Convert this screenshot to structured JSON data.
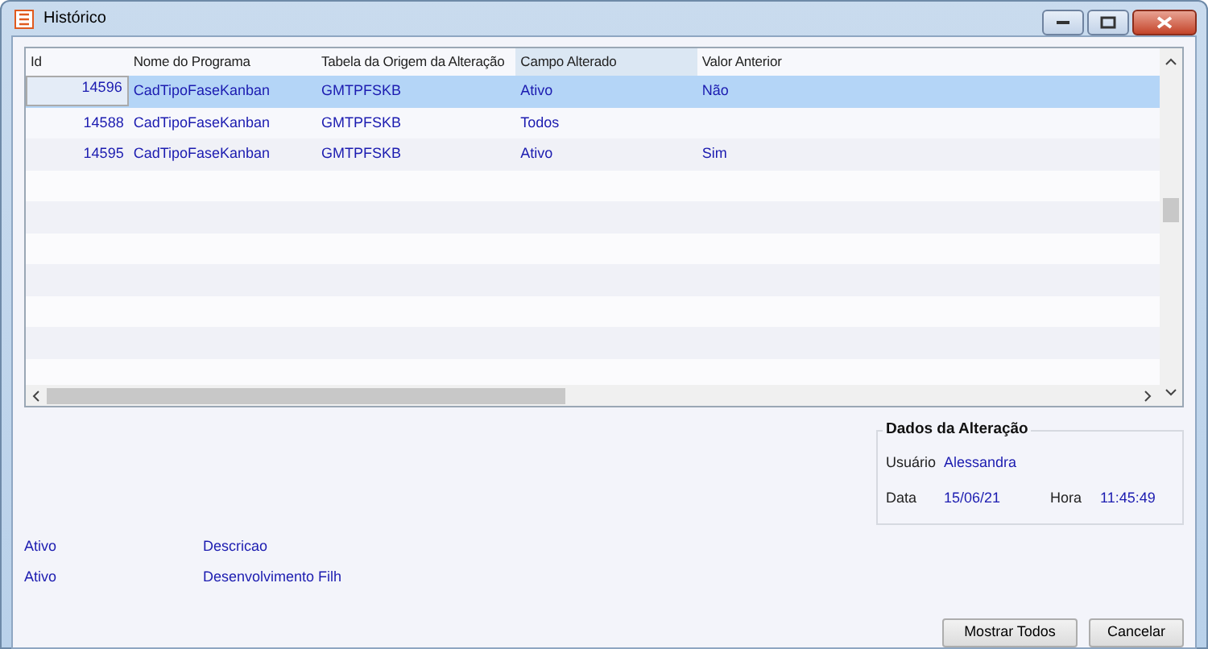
{
  "window": {
    "title": "Histórico"
  },
  "table": {
    "columns": [
      {
        "label": "Id",
        "highlighted": false
      },
      {
        "label": "Nome do Programa",
        "highlighted": false
      },
      {
        "label": "Tabela da Origem da Alteração",
        "highlighted": false
      },
      {
        "label": "Campo Alterado",
        "highlighted": true
      },
      {
        "label": "Valor Anterior",
        "highlighted": false
      }
    ],
    "rows": [
      {
        "cells": [
          "14596",
          "CadTipoFaseKanban",
          "GMTPFSKB",
          "Ativo",
          "Não"
        ],
        "selected": true
      },
      {
        "cells": [
          "14588",
          "CadTipoFaseKanban",
          "GMTPFSKB",
          "Todos",
          ""
        ],
        "selected": false
      },
      {
        "cells": [
          "14595",
          "CadTipoFaseKanban",
          "GMTPFSKB",
          "Ativo",
          "Sim"
        ],
        "selected": false
      }
    ]
  },
  "details": {
    "title": "Dados da Alteração",
    "user_label": "Usuário",
    "user": "Alessandra",
    "date_label": "Data",
    "date": "15/06/21",
    "time_label": "Hora",
    "time": "11:45:49"
  },
  "fields": [
    {
      "left": "Ativo",
      "right": "Descricao"
    },
    {
      "left": "Ativo",
      "right": "Desenvolvimento Filh"
    }
  ],
  "buttons": [
    "Mostrar Todos",
    "Cancelar"
  ]
}
